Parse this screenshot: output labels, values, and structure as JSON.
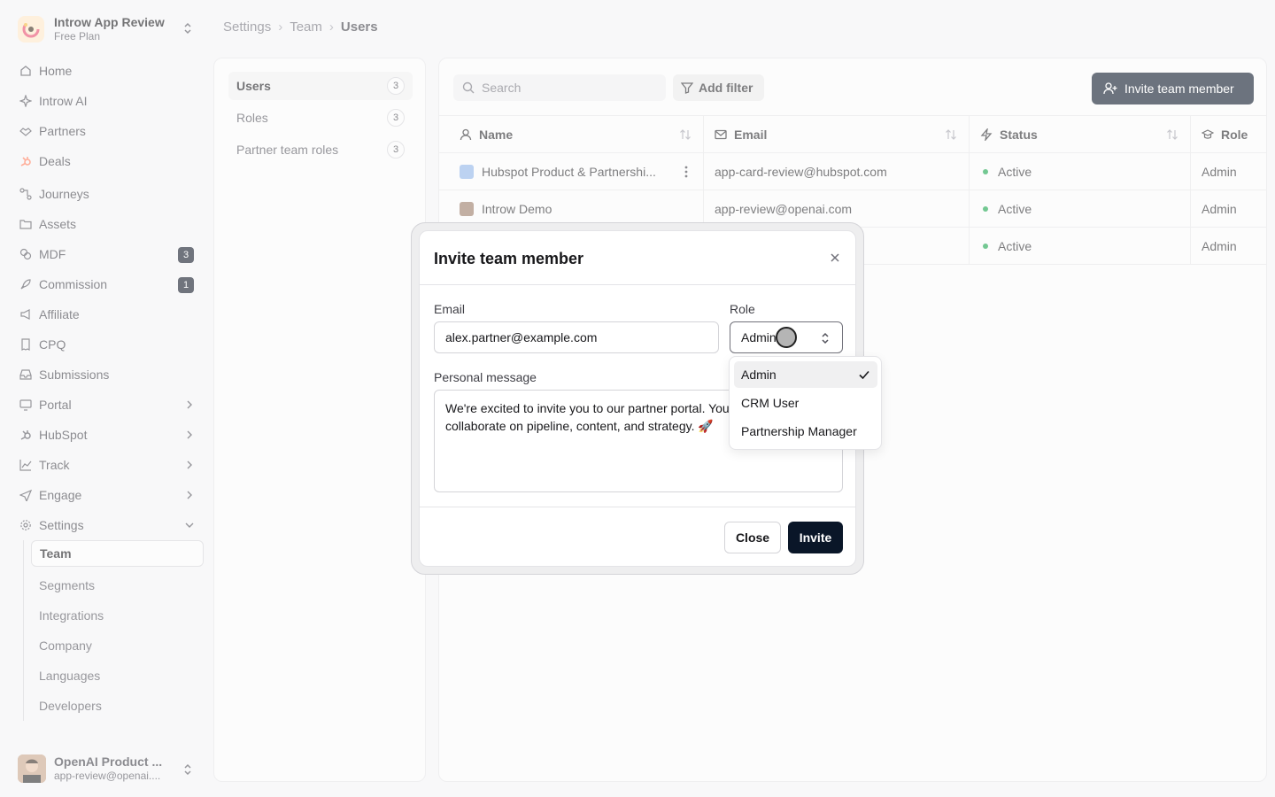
{
  "org": {
    "name": "Introw App Review",
    "plan": "Free Plan"
  },
  "sidebar": {
    "items": [
      {
        "label": "Home",
        "icon": "home-icon"
      },
      {
        "label": "Introw AI",
        "icon": "sparkle-icon"
      },
      {
        "label": "Partners",
        "icon": "handshake-icon"
      },
      {
        "label": "Deals",
        "icon": "hubspot-icon"
      },
      {
        "label": "Journeys",
        "icon": "workflow-icon"
      },
      {
        "label": "Assets",
        "icon": "folder-icon"
      },
      {
        "label": "MDF",
        "icon": "coins-icon",
        "badge": "3"
      },
      {
        "label": "Commission",
        "icon": "rocket-icon",
        "badge": "1"
      },
      {
        "label": "Affiliate",
        "icon": "megaphone-icon"
      },
      {
        "label": "CPQ",
        "icon": "receipt-icon"
      },
      {
        "label": "Submissions",
        "icon": "inbox-icon"
      },
      {
        "label": "Portal",
        "icon": "monitor-icon"
      },
      {
        "label": "HubSpot",
        "icon": "hubspot-icon"
      },
      {
        "label": "Track",
        "icon": "chart-icon"
      },
      {
        "label": "Engage",
        "icon": "send-icon"
      },
      {
        "label": "Settings",
        "icon": "gear-icon"
      }
    ],
    "settings_sub": [
      "Team",
      "Segments",
      "Integrations",
      "Company",
      "Languages",
      "Developers"
    ]
  },
  "current_user": {
    "name": "OpenAI Product ...",
    "email": "app-review@openai...."
  },
  "breadcrumb": [
    "Settings",
    "Team",
    "Users"
  ],
  "subnav": [
    {
      "label": "Users",
      "count": "3"
    },
    {
      "label": "Roles",
      "count": "3"
    },
    {
      "label": "Partner team roles",
      "count": "3"
    }
  ],
  "toolbar": {
    "search_placeholder": "Search",
    "filter_label": "Add filter",
    "invite_label": "Invite team member"
  },
  "table": {
    "headers": [
      "Name",
      "Email",
      "Status",
      "Role"
    ],
    "rows": [
      {
        "name": "Hubspot Product & Partnershi...",
        "email": "app-card-review@hubspot.com",
        "status": "Active",
        "role": "Admin"
      },
      {
        "name": "Introw Demo",
        "email": "app-review@openai.com",
        "status": "Active",
        "role": "Admin"
      },
      {
        "name": "",
        "email": "",
        "status": "Active",
        "role": "Admin"
      }
    ]
  },
  "modal": {
    "title": "Invite team member",
    "email_label": "Email",
    "email_value": "alex.partner@example.com",
    "role_label": "Role",
    "role_value": "Admin",
    "message_label": "Personal message",
    "message_value": "We're excited to invite you to our partner portal. You'll be able to collaborate on pipeline, content, and strategy. 🚀",
    "close_label": "Close",
    "invite_label": "Invite"
  },
  "role_options": [
    "Admin",
    "CRM User",
    "Partnership Manager"
  ],
  "colors": {
    "primary": "#0a1628",
    "status_active": "#16a34a",
    "background": "#f4f4f5"
  }
}
